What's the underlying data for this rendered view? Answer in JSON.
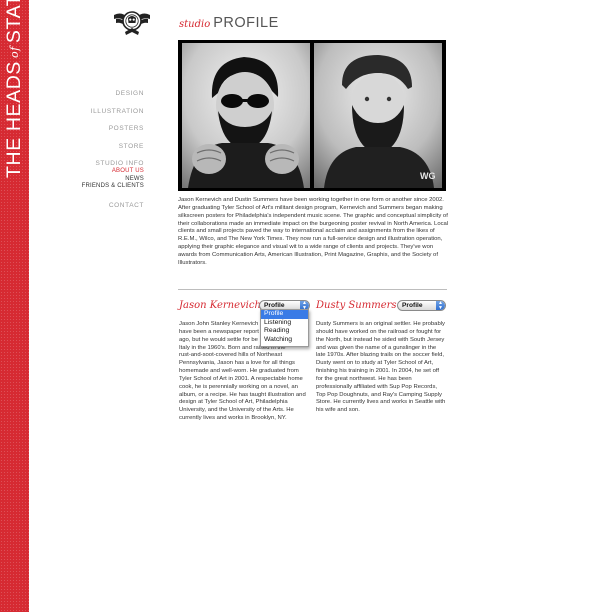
{
  "brand": {
    "title_pre": "THE HEADS",
    "title_of": "of",
    "title_post": "STATE",
    "band_color": "#d62a32",
    "logo_icon": "winged-skull-emblem-icon"
  },
  "header": {
    "studio": "studio",
    "profile": "PROFILE"
  },
  "nav": {
    "items": [
      "DESIGN",
      "ILLUSTRATION",
      "POSTERS",
      "STORE"
    ],
    "studio_info": "STUDIO INFO",
    "subitems": [
      "ABOUT US",
      "NEWS",
      "FRIENDS & CLIENTS"
    ],
    "active": "ABOUT US",
    "contact": "CONTACT"
  },
  "intro": "Jason Kernevich and Dustin Summers have been working together in one form or another since 2002. After graduating Tyler School of Art's militant design program, Kernevich and Summers began making silkscreen posters for Philadelphia's independent music scene. The graphic and conceptual simplicity of their collaborations made an immediate impact on the burgeoning poster revival in North America. Local clients and small projects paved the way to international acclaim and assignments from the likes of R.E.M., Wilco, and The New York Times. They now run a full-service design and illustration operation, applying their graphic elegance and visual wit to a wide range of clients and projects. They've won awards from Communication Arts, American Illustration, Print Magazine, Graphis, and the Society of Illustrators.",
  "people": {
    "jason": {
      "name": "Jason Kernevich",
      "select_value": "Profile",
      "options": [
        "Profile",
        "Listening",
        "Reading",
        "Watching"
      ],
      "selected_option": "Profile",
      "bio_lines": [
        "Jason John Stanley Kernevich",
        "have been a newspaper report",
        "ago, but he would settle for be",
        "Italy in the 1960's. Born and raised in the",
        "rust-and-soot-covered hills of Northeast",
        "Pennsylvania, Jason has a love for all things",
        "homemade and well-worn. He graduated from",
        "Tyler School of Art in 2001. A respectable home",
        "cook, he is perennially working on a novel, an",
        "album, or a recipe. He has taught illustration and",
        "design at Tyler School of Art, Philadelphia",
        "University, and the University of the Arts. He",
        "currently lives and works in Brooklyn, NY."
      ]
    },
    "dusty": {
      "name": "Dusty Summers",
      "select_value": "Profile",
      "bio_lines": [
        "Dusty Summers is an original settler. He probably",
        "should have worked on the railroad or fought for",
        "the North, but instead he sided with South Jersey",
        "and was given the name of a gunslinger in the",
        "late 1970s. After blazing trails on the soccer field,",
        "Dusty went on to study at Tyler School of Art,",
        "finishing his training in 2001. In 2004, he set off",
        "for the great northwest. He has been",
        "professionally affiliated with Sup Pop Records,",
        "Top Pop Doughnuts, and Ray's Camping Supply",
        "Store. He currently lives and works in Seattle with",
        "his wife and son."
      ]
    }
  },
  "photo": {
    "description_icon": "founders-photo-booth-portrait",
    "shirt_text": "WG"
  }
}
